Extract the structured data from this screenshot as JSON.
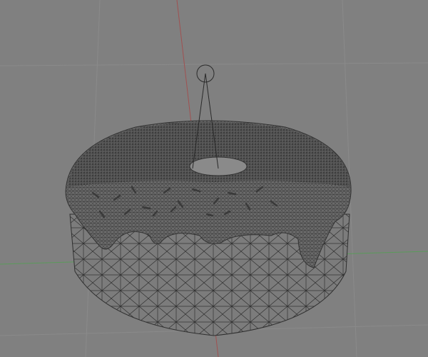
{
  "viewport": {
    "background_color": "#808080",
    "grid_color": "#8a8a8a",
    "x_axis_color": "#a05050",
    "y_axis_color": "#5a9a5a",
    "mesh_wire_color": "#2e2e2e",
    "icing_color": "#5a5a5a",
    "base_color": "#7c7c7c"
  },
  "objects": [
    {
      "name": "donut-mesh",
      "icon": "mesh-icon"
    },
    {
      "name": "light",
      "icon": "light-icon"
    }
  ]
}
